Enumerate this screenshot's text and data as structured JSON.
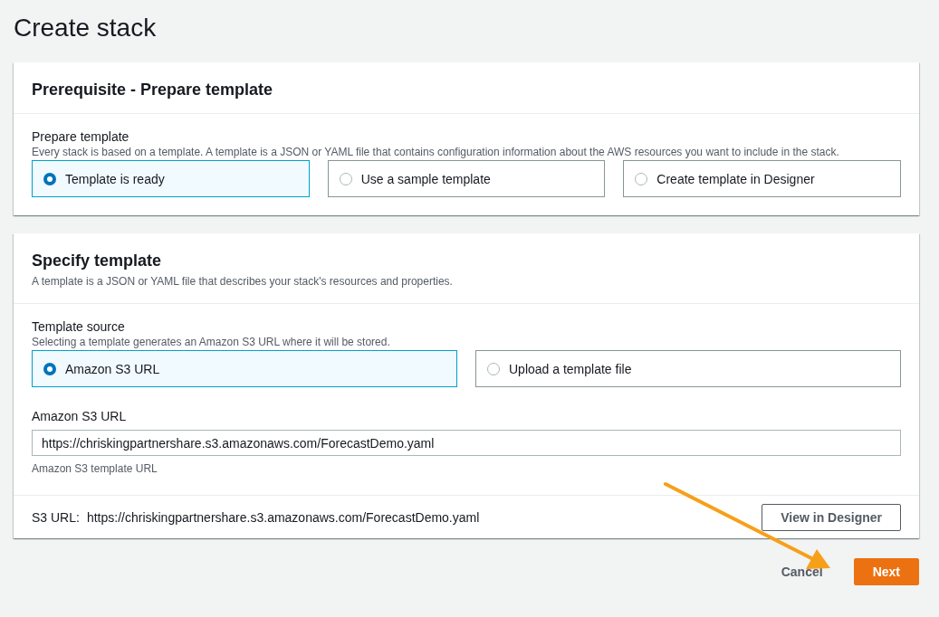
{
  "page_title": "Create stack",
  "prerequisite": {
    "title": "Prerequisite - Prepare template",
    "field": {
      "label": "Prepare template",
      "description": "Every stack is based on a template. A template is a JSON or YAML file that contains configuration information about the AWS resources you want to include in the stack.",
      "options": [
        {
          "label": "Template is ready",
          "selected": true
        },
        {
          "label": "Use a sample template",
          "selected": false
        },
        {
          "label": "Create template in Designer",
          "selected": false
        }
      ]
    }
  },
  "specify": {
    "title": "Specify template",
    "description": "A template is a JSON or YAML file that describes your stack's resources and properties.",
    "source": {
      "label": "Template source",
      "description": "Selecting a template generates an Amazon S3 URL where it will be stored.",
      "options": [
        {
          "label": "Amazon S3 URL",
          "selected": true
        },
        {
          "label": "Upload a template file",
          "selected": false
        }
      ]
    },
    "url_field": {
      "label": "Amazon S3 URL",
      "value": "https://chriskingpartnershare.s3.amazonaws.com/ForecastDemo.yaml",
      "hint": "Amazon S3 template URL"
    },
    "s3_url": {
      "label": "S3 URL:",
      "value": "https://chriskingpartnershare.s3.amazonaws.com/ForecastDemo.yaml"
    },
    "view_button": "View in Designer"
  },
  "actions": {
    "cancel": "Cancel",
    "next": "Next"
  }
}
